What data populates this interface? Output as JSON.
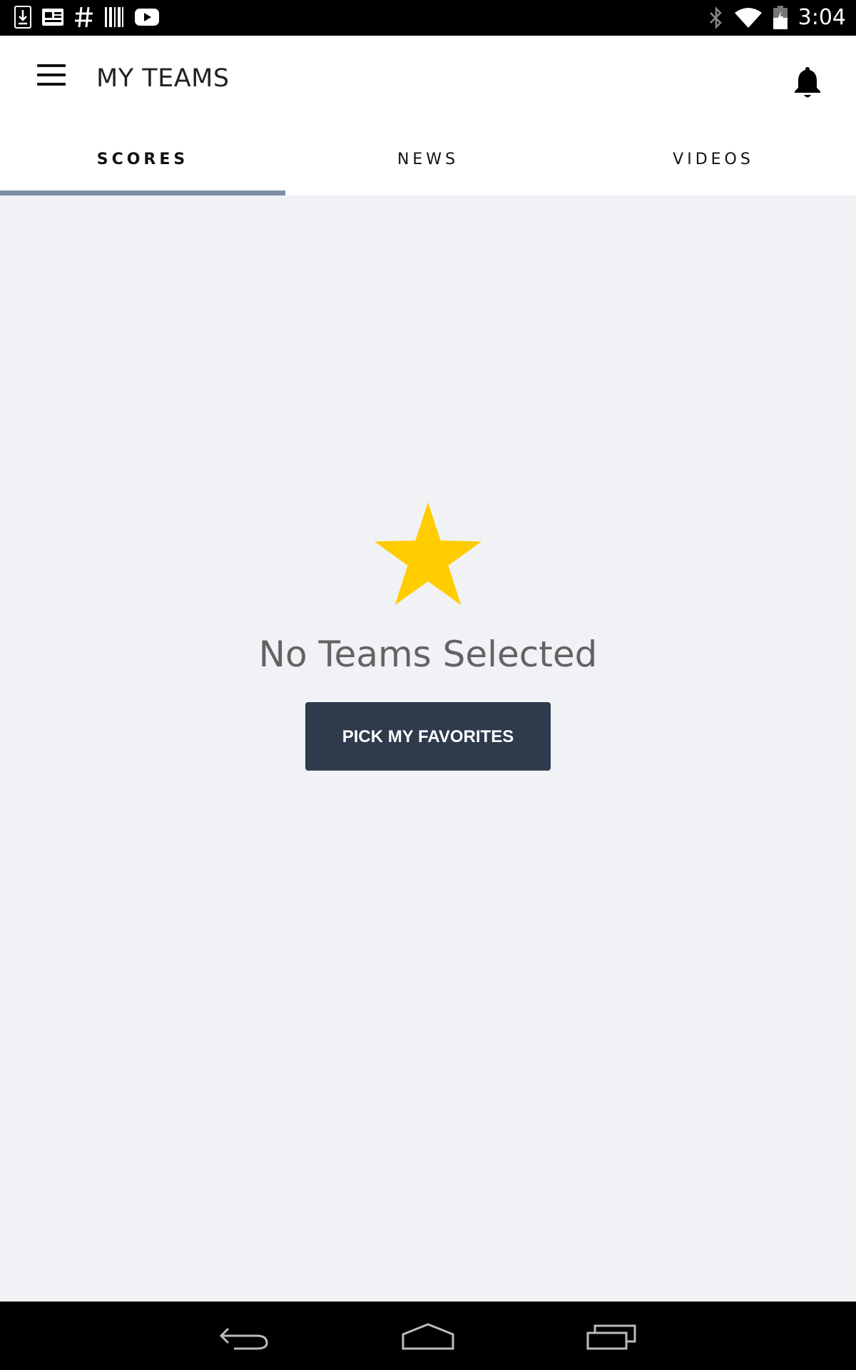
{
  "status_bar": {
    "time": "3:04",
    "left_icons": [
      "download-icon",
      "news-icon",
      "hashtag-icon",
      "barcode-icon",
      "youtube-icon"
    ],
    "right_icons": [
      "bluetooth-icon",
      "wifi-icon",
      "battery-icon"
    ]
  },
  "header": {
    "title": "MY TEAMS"
  },
  "tabs": [
    {
      "label": "SCORES",
      "selected": true
    },
    {
      "label": "NEWS",
      "selected": false
    },
    {
      "label": "VIDEOS",
      "selected": false
    }
  ],
  "empty_state": {
    "title": "No Teams Selected",
    "button_label": "PICK MY FAVORITES",
    "icon": "star-icon"
  },
  "colors": {
    "accent_star": "#ffcc00",
    "tab_indicator": "#7e8fa6",
    "button_bg": "#303a4d",
    "content_bg": "#f0f2f6"
  },
  "nav_bar": {
    "buttons": [
      "back-icon",
      "home-icon",
      "recents-icon"
    ]
  }
}
